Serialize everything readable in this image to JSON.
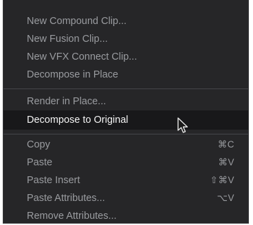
{
  "menu": {
    "group1": [
      {
        "label": "New Compound Clip..."
      },
      {
        "label": "New Fusion Clip..."
      },
      {
        "label": "New VFX Connect Clip..."
      },
      {
        "label": "Decompose in Place"
      }
    ],
    "group2": [
      {
        "label": "Render in Place..."
      },
      {
        "label": "Decompose to Original",
        "highlighted": true
      }
    ],
    "group3": [
      {
        "label": "Copy",
        "shortcut": "⌘C"
      },
      {
        "label": "Paste",
        "shortcut": "⌘V"
      },
      {
        "label": "Paste Insert",
        "shortcut": "⇧⌘V"
      },
      {
        "label": "Paste Attributes...",
        "shortcut": "⌥V"
      },
      {
        "label": "Remove Attributes..."
      }
    ]
  },
  "colors": {
    "menu_background": "#262628",
    "highlight_background": "#18181a",
    "text": "#9a9ca0",
    "highlight_text": "#f4f4f4"
  },
  "cursor": {
    "icon": "mouse-pointer-icon"
  }
}
